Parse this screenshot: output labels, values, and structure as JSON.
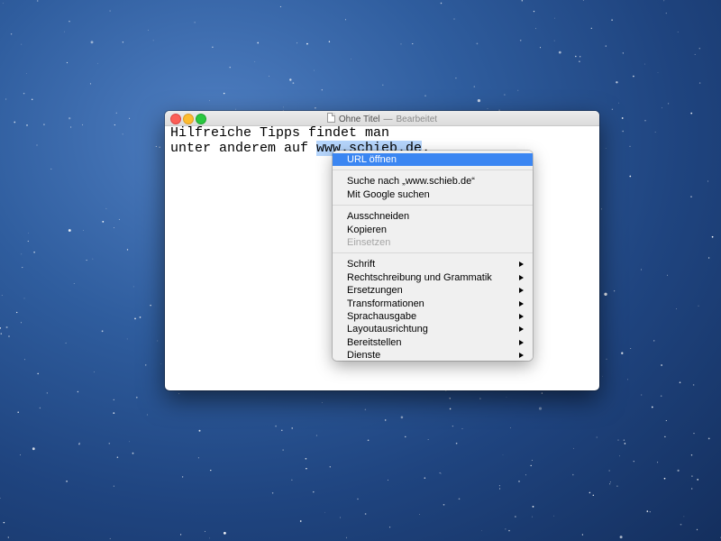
{
  "window": {
    "title": "Ohne Titel",
    "title_separator": "—",
    "status": "Bearbeitet",
    "doc_icon": "document-icon"
  },
  "document": {
    "line1": "Hilfreiche Tipps findet man",
    "line2_prefix": "unter anderem auf ",
    "line2_selected": "www.schieb.de",
    "line2_suffix": ".",
    "selection_color": "#b5d5fc"
  },
  "context_menu": {
    "highlight_color": "#3b86f2",
    "groups": [
      [
        {
          "label": "URL öffnen",
          "highlighted": true
        }
      ],
      [
        {
          "label": "Suche nach „www.schieb.de“"
        },
        {
          "label": "Mit Google suchen"
        }
      ],
      [
        {
          "label": "Ausschneiden"
        },
        {
          "label": "Kopieren"
        },
        {
          "label": "Einsetzen",
          "disabled": true
        }
      ],
      [
        {
          "label": "Schrift",
          "submenu": true
        },
        {
          "label": "Rechtschreibung und Grammatik",
          "submenu": true
        },
        {
          "label": "Ersetzungen",
          "submenu": true
        },
        {
          "label": "Transformationen",
          "submenu": true
        },
        {
          "label": "Sprachausgabe",
          "submenu": true
        },
        {
          "label": "Layoutausrichtung",
          "submenu": true
        },
        {
          "label": "Bereitstellen",
          "submenu": true
        },
        {
          "label": "Dienste",
          "submenu": true
        }
      ]
    ]
  }
}
